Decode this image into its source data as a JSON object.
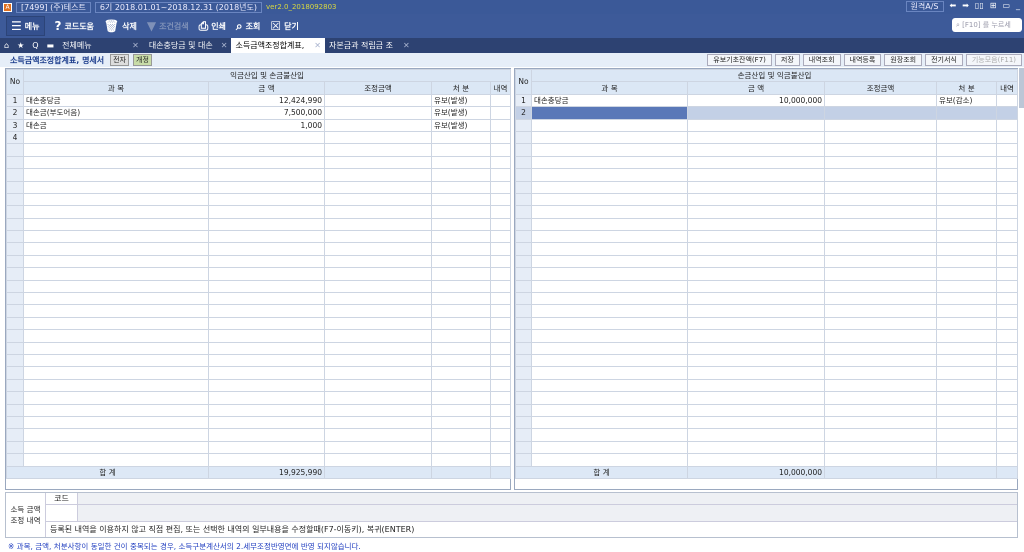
{
  "topbar": {
    "company": "[7499] (주)테스트",
    "period": "6기 2018.01.01~2018.12.31 (2018년도)",
    "version": "ver2.0_2018092803",
    "remote": "원격A/S"
  },
  "toolbar": {
    "menu": "메뉴",
    "code_help": "코드도움",
    "delete": "삭제",
    "filter": "조건검색",
    "print": "인쇄",
    "view": "조회",
    "close": "닫기",
    "search_placeholder": "[F10] 를 누르세"
  },
  "tabs": [
    "전체메뉴",
    "대손충당금 및 대손",
    "소득금액조정합계표,",
    "자본금과 적립금 조"
  ],
  "subbar": {
    "title": "소득금액조정합계표, 명세서",
    "tag1": "전자",
    "tag2": "개정",
    "buttons": [
      "유보기초잔액(F7)",
      "저장",
      "내역조회",
      "내역등록",
      "원장조회",
      "전기서식",
      "기능모음(F11)"
    ]
  },
  "left": {
    "group": "익금산입 및 손금불산입",
    "headers": [
      "No",
      "과 목",
      "금 액",
      "조정금액",
      "처 분",
      "내역"
    ],
    "rows": [
      [
        "1",
        "대손충당금",
        "12,424,990",
        "",
        "유보(발생)",
        ""
      ],
      [
        "2",
        "대손금(부도어음)",
        "7,500,000",
        "",
        "유보(발생)",
        ""
      ],
      [
        "3",
        "대손금",
        "1,000",
        "",
        "유보(발생)",
        ""
      ],
      [
        "4",
        "",
        "",
        "",
        "",
        ""
      ]
    ],
    "total_label": "합 계",
    "total": "19,925,990"
  },
  "right": {
    "group": "손금산입 및 익금불산입",
    "headers": [
      "No",
      "과 목",
      "금 액",
      "조정금액",
      "처 분",
      "내역"
    ],
    "rows": [
      [
        "1",
        "대손충당금",
        "10,000,000",
        "",
        "유보(감소)",
        ""
      ],
      [
        "2",
        "",
        "",
        "",
        "",
        ""
      ]
    ],
    "total_label": "합 계",
    "total": "10,000,000"
  },
  "bottom": {
    "label": "소득 금액 조정 내역",
    "code": "코드",
    "hint": "등록된 내역을 이용하지 않고 직접 편집, 또는 선택한 내역의 일부내용을 수정할때(F7-이동키), 복귀(ENTER)"
  },
  "note": "※ 과목, 금액, 처분사항이 동일한 건이 중복되는 경우, 소득구분계산서의 2.세무조정반영면에 반영 되지않습니다."
}
